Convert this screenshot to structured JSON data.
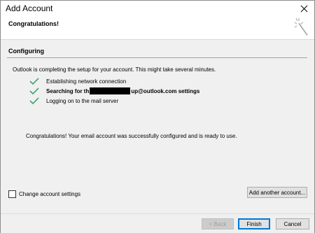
{
  "window": {
    "title": "Add Account"
  },
  "header": {
    "heading": "Congratulations!"
  },
  "configuring": {
    "section_title": "Configuring",
    "status": "Outlook is completing the setup for your account. This might take several minutes.",
    "steps": [
      {
        "label": "Establishing network connection",
        "bold": false
      },
      {
        "label_prefix": "Searching for th",
        "label_suffix": "up@outlook.com settings",
        "bold": true,
        "redacted": true
      },
      {
        "label": "Logging on to the mail server",
        "bold": false
      }
    ],
    "success_message": "Congratulations! Your email account was successfully configured and is ready to use."
  },
  "options": {
    "change_settings_label": "Change account settings",
    "change_settings_checked": false,
    "add_another_label": "Add another account..."
  },
  "footer": {
    "back_label": "< Back",
    "finish_label": "Finish",
    "cancel_label": "Cancel"
  },
  "colors": {
    "check": "#3fa66d",
    "accent": "#0078d7"
  },
  "icons": {
    "close": "close-icon",
    "wizard": "magic-wand-icon",
    "check": "checkmark-icon"
  }
}
